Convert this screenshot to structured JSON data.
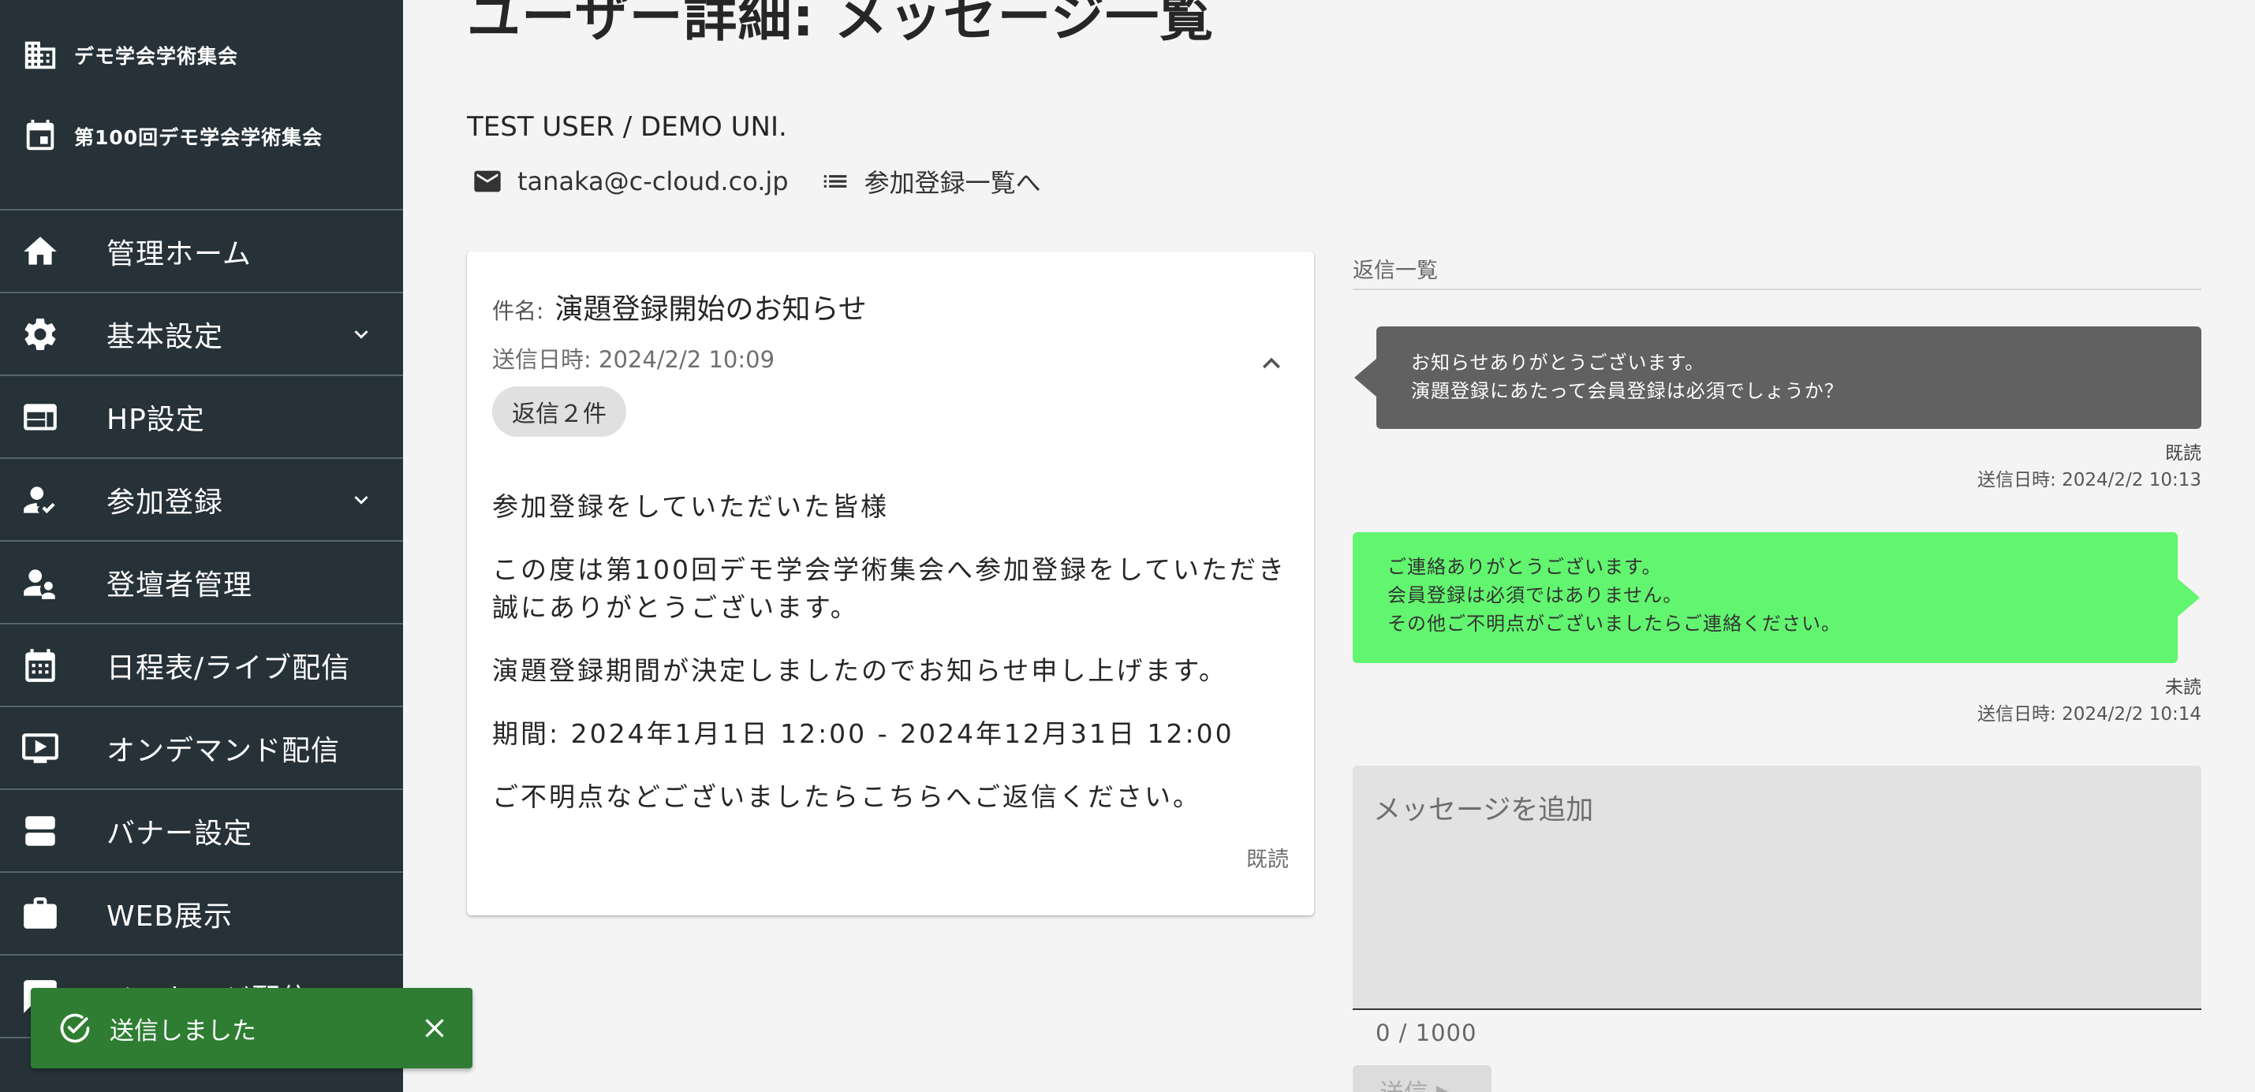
{
  "sidebar": {
    "org_name": "デモ学会学術集会",
    "event_name": "第100回デモ学会学術集会",
    "items": [
      {
        "label": "管理ホーム",
        "icon": "home-icon"
      },
      {
        "label": "基本設定",
        "icon": "gear-icon",
        "expandable": true
      },
      {
        "label": "HP設定",
        "icon": "web-layout-icon"
      },
      {
        "label": "参加登録",
        "icon": "person-check-icon",
        "expandable": true
      },
      {
        "label": "登壇者管理",
        "icon": "speaker-group-icon"
      },
      {
        "label": "日程表/ライブ配信",
        "icon": "calendar-icon"
      },
      {
        "label": "オンデマンド配信",
        "icon": "video-icon"
      },
      {
        "label": "バナー設定",
        "icon": "banner-icon"
      },
      {
        "label": "WEB展示",
        "icon": "briefcase-icon"
      },
      {
        "label": "メッセージ配信",
        "icon": "message-icon"
      }
    ]
  },
  "page": {
    "title": "ユーザー詳細: メッセージ一覧",
    "user": "TEST USER / DEMO UNI.",
    "email": "tanaka@c-cloud.co.jp",
    "registration_link": "参加登録一覧へ"
  },
  "message": {
    "subject_label": "件名:",
    "subject": "演題登録開始のお知らせ",
    "sent_at": "送信日時: 2024/2/2 10:09",
    "reply_chip": "返信２件",
    "body": [
      "参加登録をしていただいた皆様",
      "この度は第100回デモ学会学術集会へ参加登録をしていただき誠にありがとうございます。",
      "演題登録期間が決定しましたのでお知らせ申し上げます。",
      "期間: 2024年1月1日 12:00 - 2024年12月31日 12:00",
      "ご不明点などございましたらこちらへご返信ください。"
    ],
    "status": "既読"
  },
  "replies": {
    "header": "返信一覧",
    "items": [
      {
        "direction": "incoming",
        "lines": [
          "お知らせありがとうございます。",
          "演題登録にあたって会員登録は必須でしょうか？"
        ],
        "status": "既読",
        "sent_at": "送信日時: 2024/2/2 10:13"
      },
      {
        "direction": "outgoing",
        "lines": [
          "ご連絡ありがとうございます。",
          "会員登録は必須ではありません。",
          "その他ご不明点がございましたらご連絡ください。"
        ],
        "status": "未読",
        "sent_at": "送信日時: 2024/2/2 10:14"
      }
    ]
  },
  "composer": {
    "placeholder": "メッセージを追加",
    "value": "",
    "counter": "0 / 1000",
    "send_label": "送信 ▶"
  },
  "snackbar": {
    "message": "送信しました"
  },
  "colors": {
    "sidebar_bg": "#263238",
    "incoming_bubble": "#616161",
    "outgoing_bubble": "#62f56f",
    "snackbar_bg": "#2e7d32"
  }
}
